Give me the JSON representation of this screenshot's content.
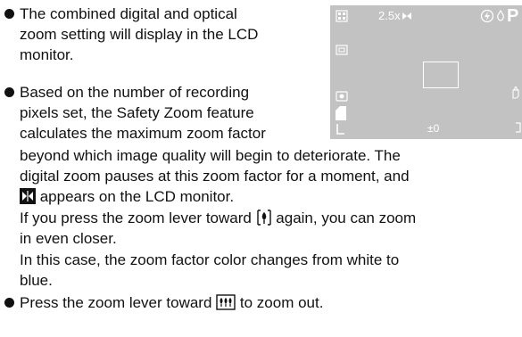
{
  "bullets": [
    {
      "lines": [
        "The combined digital and optical",
        "zoom setting will display in the LCD",
        "monitor."
      ]
    },
    {
      "lines": [
        "Based on the number of recording",
        "pixels set, the Safety Zoom feature",
        "calculates the maximum zoom factor",
        "beyond which image quality will begin to deteriorate. The",
        "digital zoom pauses at this zoom factor for a moment, and"
      ],
      "icon_line_suffix": " appears on the LCD monitor.",
      "press_again": {
        "before": "If you press the zoom lever toward ",
        "after": " again, you can zoom",
        "continued": "in even closer."
      },
      "color_note": [
        "In this case, the zoom factor color changes from white to",
        "blue."
      ]
    },
    {
      "before": "Press the zoom lever toward ",
      "after": " to zoom out."
    }
  ],
  "lcd": {
    "zoom_readout": "2.5x",
    "mode_letter": "P",
    "exposure_value": "±0"
  },
  "icons": {
    "safety_zoom": "safety-zoom-icon",
    "tele": "telephoto-icon",
    "wide": "wide-angle-icon"
  },
  "colors": {
    "text": "#111111",
    "lcd_background": "#c2c2c2",
    "lcd_overlay": "#ffffff"
  }
}
